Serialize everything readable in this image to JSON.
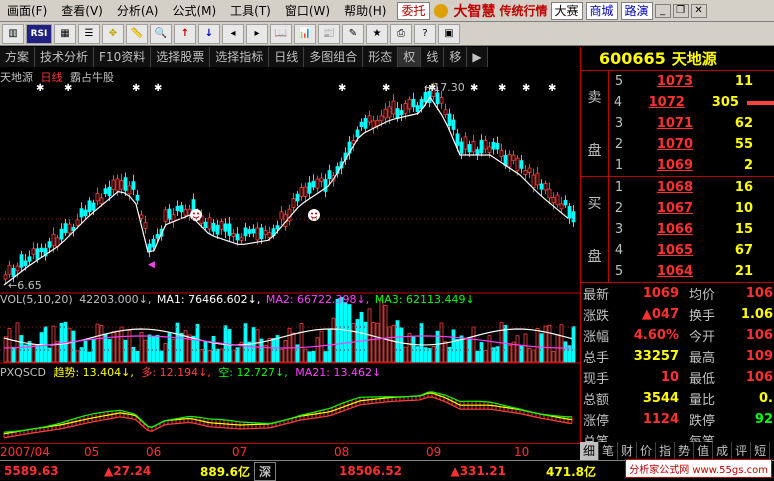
{
  "menubar": {
    "items": [
      "画面(F)",
      "查看(V)",
      "分析(A)",
      "公式(M)",
      "工具(T)",
      "窗口(W)",
      "帮助(H)"
    ],
    "delegate_btn": "委托",
    "brand": "大智慧",
    "brand_sub": "传统行情",
    "contest": "大赛",
    "mall": "商城",
    "roadshow": "路演"
  },
  "toolbar": {
    "rsi_label": "RSI"
  },
  "tabs": [
    "方案",
    "技术分析",
    "F10资料",
    "选择股票",
    "选择指标",
    "日线",
    "多图组合",
    "形态",
    "权",
    "线",
    "移"
  ],
  "chart": {
    "stock_name": "天地源",
    "period": "日线",
    "indicator_name": "霸占牛股",
    "high_label": "17.30",
    "low_label": "6.65",
    "vol_legend": {
      "label": "VOL(5,10,20)",
      "vol": "42203.000",
      "ma1": "MA1: 76466.602",
      "ma2": "MA2: 66722.398",
      "ma3": "MA3: 62113.449"
    },
    "ind_legend": {
      "label": "PXQSCD",
      "trend": "趋势: 13.404",
      "long": "多: 12.194",
      "short": "空: 12.727",
      "ma21": "MA21: 13.462"
    },
    "x_labels": [
      "2007/04",
      "05",
      "06",
      "07",
      "08",
      "09",
      "10"
    ]
  },
  "quote": {
    "code": "600665",
    "name": "天地源",
    "sell_label_1": "卖",
    "sell_label_2": "盘",
    "buy_label_1": "买",
    "buy_label_2": "盘",
    "asks": [
      {
        "lvl": "5",
        "price": "1073",
        "vol": "11",
        "bar": 0
      },
      {
        "lvl": "4",
        "price": "1072",
        "vol": "305",
        "bar": 1
      },
      {
        "lvl": "3",
        "price": "1071",
        "vol": "62",
        "bar": 0
      },
      {
        "lvl": "2",
        "price": "1070",
        "vol": "55",
        "bar": 0
      },
      {
        "lvl": "1",
        "price": "1069",
        "vol": "2",
        "bar": 0
      }
    ],
    "bids": [
      {
        "lvl": "1",
        "price": "1068",
        "vol": "16"
      },
      {
        "lvl": "2",
        "price": "1067",
        "vol": "10"
      },
      {
        "lvl": "3",
        "price": "1066",
        "vol": "15"
      },
      {
        "lvl": "4",
        "price": "1065",
        "vol": "67"
      },
      {
        "lvl": "5",
        "price": "1064",
        "vol": "21"
      }
    ],
    "info": [
      {
        "l1": "最新",
        "v1": "1069",
        "c1": "red",
        "l2": "均价",
        "v2": "106",
        "c2": "red"
      },
      {
        "l1": "涨跌",
        "v1": "▲047",
        "c1": "red",
        "l2": "换手",
        "v2": "1.06",
        "c2": "yellow"
      },
      {
        "l1": "涨幅",
        "v1": "4.60%",
        "c1": "red",
        "l2": "今开",
        "v2": "106",
        "c2": "red"
      },
      {
        "l1": "总手",
        "v1": "33257",
        "c1": "yellow",
        "l2": "最高",
        "v2": "109",
        "c2": "red"
      },
      {
        "l1": "现手",
        "v1": "10",
        "c1": "red",
        "l2": "最低",
        "v2": "106",
        "c2": "red"
      },
      {
        "l1": "总额",
        "v1": "3544",
        "c1": "yellow",
        "l2": "量比",
        "v2": "0.",
        "c2": "yellow"
      },
      {
        "l1": "涨停",
        "v1": "1124",
        "c1": "red",
        "l2": "跌停",
        "v2": "92",
        "c2": "green"
      },
      {
        "l1": "总笔",
        "v1": "",
        "c1": "yellow",
        "l2": "每笔",
        "v2": "",
        "c2": "yellow"
      }
    ],
    "bottom_tabs": [
      "细",
      "笔",
      "财",
      "价",
      "指",
      "势",
      "值",
      "成",
      "评",
      "短"
    ]
  },
  "status": {
    "idx1": "5589.63",
    "chg1": "▲27.24",
    "amt1": "889.6亿",
    "market2": "深",
    "idx2": "18506.52",
    "chg2": "▲331.21",
    "amt2": "471.8亿",
    "watermark": "分析家公式网 www.55gs.com"
  }
}
